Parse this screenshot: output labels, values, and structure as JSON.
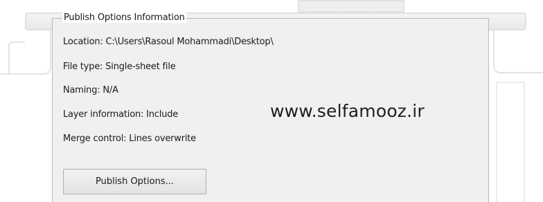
{
  "group": {
    "title": "Publish Options Information"
  },
  "info": {
    "location": "Location: C:\\Users\\Rasoul Mohammadi\\Desktop\\",
    "file_type": "File type: Single-sheet file",
    "naming": "Naming: N/A",
    "layer_information": "Layer information: Include",
    "merge_control": "Merge control: Lines overwrite"
  },
  "watermark": "www.selfamooz.ir",
  "buttons": {
    "publish_options": "Publish Options..."
  },
  "colors": {
    "panel_background": "#f0f0f0",
    "panel_border": "#b9b9b9",
    "text": "#1a1a1a"
  }
}
